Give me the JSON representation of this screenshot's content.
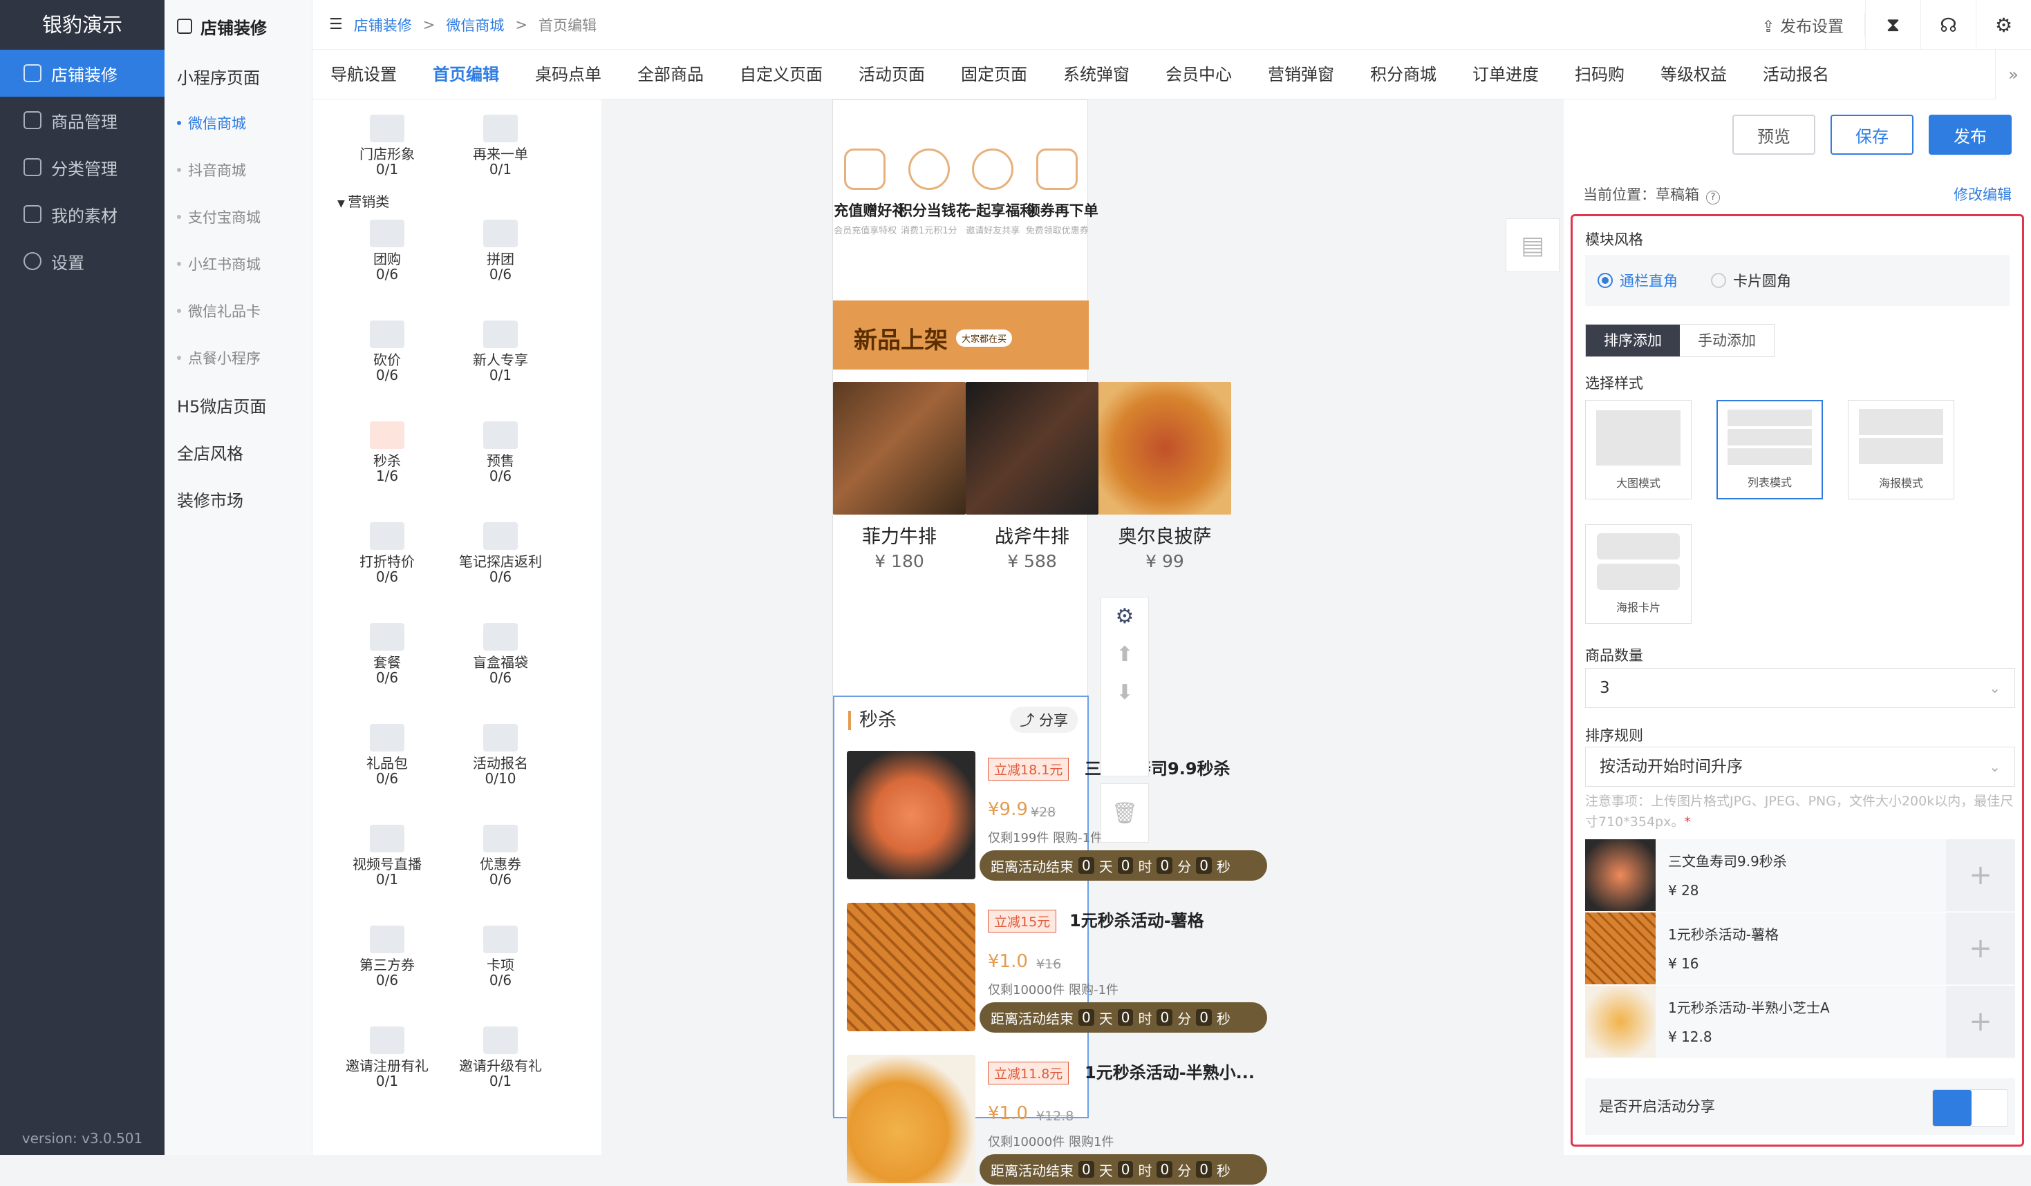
{
  "app": {
    "brand": "银豹演示",
    "version": "version: v3.0.501"
  },
  "nav": [
    {
      "label": "店铺装修",
      "icon": "store-icon"
    },
    {
      "label": "商品管理",
      "icon": "goods-icon"
    },
    {
      "label": "分类管理",
      "icon": "category-icon"
    },
    {
      "label": "我的素材",
      "icon": "image-icon"
    },
    {
      "label": "设置",
      "icon": "gear-icon"
    }
  ],
  "subnav": {
    "title": "店铺装修",
    "group1": "小程序页面",
    "items": [
      "微信商城",
      "抖音商城",
      "支付宝商城",
      "小红书商城",
      "微信礼品卡",
      "点餐小程序"
    ],
    "group2": "H5微店页面",
    "group3": "全店风格",
    "group4": "装修市场"
  },
  "breadcrumb": {
    "a": "店铺装修",
    "b": "微信商城",
    "c": "首页编辑",
    "sep": ">"
  },
  "topbar": {
    "publish_settings": "发布设置"
  },
  "tabs": [
    "导航设置",
    "首页编辑",
    "桌码点单",
    "全部商品",
    "自定义页面",
    "活动页面",
    "固定页面",
    "系统弹窗",
    "会员中心",
    "营销弹窗",
    "积分商城",
    "订单进度",
    "扫码购",
    "等级权益",
    "活动报名"
  ],
  "palette": {
    "category": "营销类",
    "items": [
      {
        "name": "门店形象",
        "count": "0/1"
      },
      {
        "name": "再来一单",
        "count": "0/1"
      },
      {
        "name": "团购",
        "count": "0/6"
      },
      {
        "name": "拼团",
        "count": "0/6"
      },
      {
        "name": "砍价",
        "count": "0/6"
      },
      {
        "name": "新人专享",
        "count": "0/1"
      },
      {
        "name": "秒杀",
        "count": "1/6"
      },
      {
        "name": "预售",
        "count": "0/6"
      },
      {
        "name": "打折特价",
        "count": "0/6"
      },
      {
        "name": "笔记探店返利",
        "count": "0/6"
      },
      {
        "name": "套餐",
        "count": "0/6"
      },
      {
        "name": "盲盒福袋",
        "count": "0/6"
      },
      {
        "name": "礼品包",
        "count": "0/6"
      },
      {
        "name": "活动报名",
        "count": "0/10"
      },
      {
        "name": "视频号直播",
        "count": "0/1"
      },
      {
        "name": "优惠券",
        "count": "0/6"
      },
      {
        "name": "第三方券",
        "count": "0/6"
      },
      {
        "name": "卡项",
        "count": "0/6"
      },
      {
        "name": "邀请注册有礼",
        "count": "0/1"
      },
      {
        "name": "邀请升级有礼",
        "count": "0/1"
      }
    ]
  },
  "preview": {
    "entries": [
      {
        "title": "充值赠好礼",
        "sub": "会员充值享特权"
      },
      {
        "title": "积分当钱花",
        "sub": "消费1元积1分"
      },
      {
        "title": "一起享福利",
        "sub": "邀请好友共享"
      },
      {
        "title": "领券再下单",
        "sub": "免费领取优惠券"
      }
    ],
    "new_title": "新品上架",
    "new_badge": "大家都在买",
    "products": [
      {
        "name": "菲力牛排",
        "price": "¥ 180"
      },
      {
        "name": "战斧牛排",
        "price": "¥ 588"
      },
      {
        "name": "奥尔良披萨",
        "price": "¥ 99"
      }
    ],
    "seckill": {
      "title": "秒杀",
      "share": "分享",
      "items": [
        {
          "tag": "立减18.1元",
          "title": "三文鱼寿司9.9秒杀",
          "price": "¥9.9",
          "old": "¥28",
          "stock": "仅剩199件 限购-1件"
        },
        {
          "tag": "立减15元",
          "title": "1元秒杀活动-薯格",
          "price": "¥1.0",
          "old": "¥16",
          "stock": "仅剩10000件 限购-1件"
        },
        {
          "tag": "立减11.8元",
          "title": "1元秒杀活动-半熟小...",
          "price": "¥1.0",
          "old": "¥12.8",
          "stock": "仅剩10000件 限购1件"
        }
      ],
      "countdown": {
        "prefix": "距离活动结束",
        "d": "0",
        "du": "天",
        "h": "0",
        "hu": "时",
        "m": "0",
        "mu": "分",
        "s": "0",
        "su": "秒"
      }
    }
  },
  "right": {
    "preview_btn": "预览",
    "save_btn": "保存",
    "publish_btn": "发布",
    "location": "当前位置：草稿箱",
    "edit": "修改编辑",
    "style_label": "模块风格",
    "radio1": "通栏直角",
    "radio2": "卡片圆角",
    "seg1": "排序添加",
    "seg2": "手动添加",
    "choose_style": "选择样式",
    "styles": [
      "大图模式",
      "列表模式",
      "海报模式",
      "海报卡片"
    ],
    "qty_label": "商品数量",
    "qty_value": "3",
    "sort_label": "排序规则",
    "sort_value": "按活动开始时间升序",
    "note": "注意事项：上传图片格式JPG、JPEG、PNG，文件大小200k以内，最佳尺寸710*354px。",
    "note_star": "*",
    "list": [
      {
        "name": "三文鱼寿司9.9秒杀",
        "price": "¥ 28"
      },
      {
        "name": "1元秒杀活动-薯格",
        "price": "¥ 16"
      },
      {
        "name": "1元秒杀活动-半熟小芝士A",
        "price": "¥ 12.8"
      }
    ],
    "share_label": "是否开启活动分享"
  },
  "colors": {
    "accent": "#2f7de1",
    "sidebar": "#2f3542",
    "highlight": "#e2344d",
    "orange": "#e49b4f"
  }
}
